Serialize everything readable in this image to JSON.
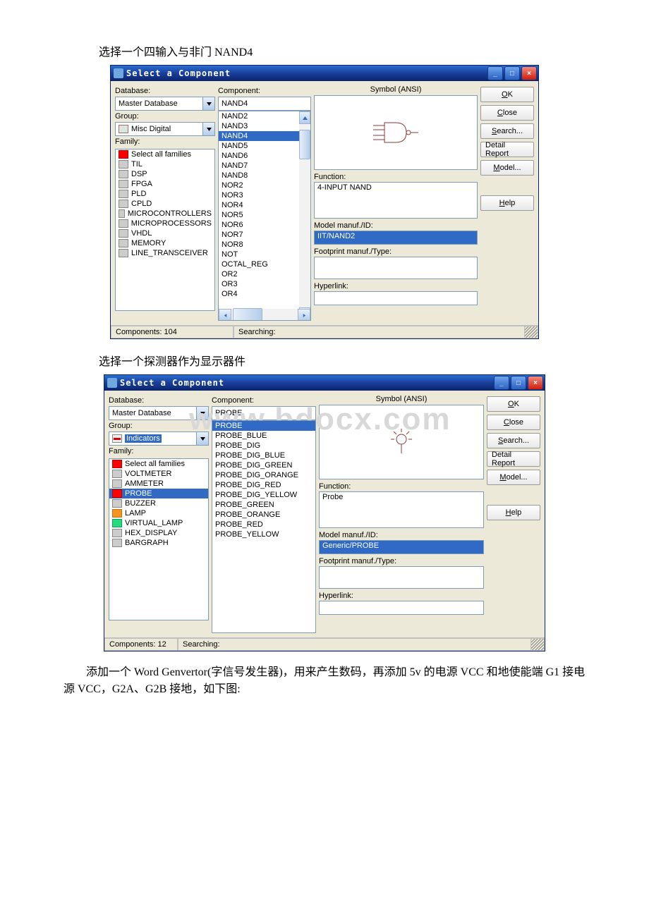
{
  "intro_text_1": "选择一个四输入与非门 NAND4",
  "intro_text_2": "选择一个探测器作为显示器件",
  "para_text": "添加一个 Word Genvertor(字信号发生器)，用来产生数码，再添加 5v 的电源 VCC 和地使能端 G1 接电源 VCC，G2A、G2B 接地，如下图:",
  "watermark": "www.bdocx.com",
  "dialog1": {
    "title": "Select a Component",
    "labels": {
      "database": "Database:",
      "group": "Group:",
      "family": "Family:",
      "component": "Component:",
      "symbol": "Symbol (ANSI)",
      "function": "Function:",
      "model": "Model manuf./ID:",
      "footprint": "Footprint manuf./Type:",
      "hyperlink": "Hyperlink:"
    },
    "database_value": "Master Database",
    "group_value": "Misc Digital",
    "component_value": "NAND4",
    "families": [
      {
        "label": "Select all families",
        "icon": "red"
      },
      {
        "label": "TIL",
        "icon": "gray"
      },
      {
        "label": "DSP",
        "icon": "gray"
      },
      {
        "label": "FPGA",
        "icon": "gray"
      },
      {
        "label": "PLD",
        "icon": "gray"
      },
      {
        "label": "CPLD",
        "icon": "gray"
      },
      {
        "label": "MICROCONTROLLERS",
        "icon": "gray"
      },
      {
        "label": "MICROPROCESSORS",
        "icon": "gray"
      },
      {
        "label": "VHDL",
        "icon": "gray"
      },
      {
        "label": "MEMORY",
        "icon": "gray"
      },
      {
        "label": "LINE_TRANSCEIVER",
        "icon": "gray"
      }
    ],
    "components": [
      "NAND2",
      "NAND3",
      "NAND4",
      "NAND5",
      "NAND6",
      "NAND7",
      "NAND8",
      "NOR2",
      "NOR3",
      "NOR4",
      "NOR5",
      "NOR6",
      "NOR7",
      "NOR8",
      "NOT",
      "OCTAL_REG",
      "OR2",
      "OR3",
      "OR4"
    ],
    "component_selected": "NAND4",
    "function_value": "4-INPUT NAND",
    "model_value": "IIT/NAND2",
    "status_components": "Components: 104",
    "status_searching": "Searching:",
    "buttons": {
      "ok": "OK",
      "close": "Close",
      "search": "Search...",
      "detail": "Detail Report",
      "model": "Model...",
      "help": "Help"
    }
  },
  "dialog2": {
    "title": "Select a Component",
    "labels": {
      "database": "Database:",
      "group": "Group:",
      "family": "Family:",
      "component": "Component:",
      "symbol": "Symbol (ANSI)",
      "function": "Function:",
      "model": "Model manuf./ID:",
      "footprint": "Footprint manuf./Type:",
      "hyperlink": "Hyperlink:"
    },
    "database_value": "Master Database",
    "group_value": "Indicators",
    "component_value": "PROBE",
    "families": [
      {
        "label": "Select all families",
        "icon": "red"
      },
      {
        "label": "VOLTMETER",
        "icon": "gray"
      },
      {
        "label": "AMMETER",
        "icon": "gray"
      },
      {
        "label": "PROBE",
        "icon": "red"
      },
      {
        "label": "BUZZER",
        "icon": "gray"
      },
      {
        "label": "LAMP",
        "icon": "orange"
      },
      {
        "label": "VIRTUAL_LAMP",
        "icon": "green"
      },
      {
        "label": "HEX_DISPLAY",
        "icon": "gray"
      },
      {
        "label": "BARGRAPH",
        "icon": "gray"
      }
    ],
    "family_selected": "PROBE",
    "components": [
      "PROBE",
      "PROBE_BLUE",
      "PROBE_DIG",
      "PROBE_DIG_BLUE",
      "PROBE_DIG_GREEN",
      "PROBE_DIG_ORANGE",
      "PROBE_DIG_RED",
      "PROBE_DIG_YELLOW",
      "PROBE_GREEN",
      "PROBE_ORANGE",
      "PROBE_RED",
      "PROBE_YELLOW"
    ],
    "component_selected": "PROBE",
    "function_value": "Probe",
    "model_value": "Generic/PROBE",
    "status_components": "Components: 12",
    "status_searching": "Searching:",
    "buttons": {
      "ok": "OK",
      "close": "Close",
      "search": "Search...",
      "detail": "Detail Report",
      "model": "Model...",
      "help": "Help"
    }
  }
}
